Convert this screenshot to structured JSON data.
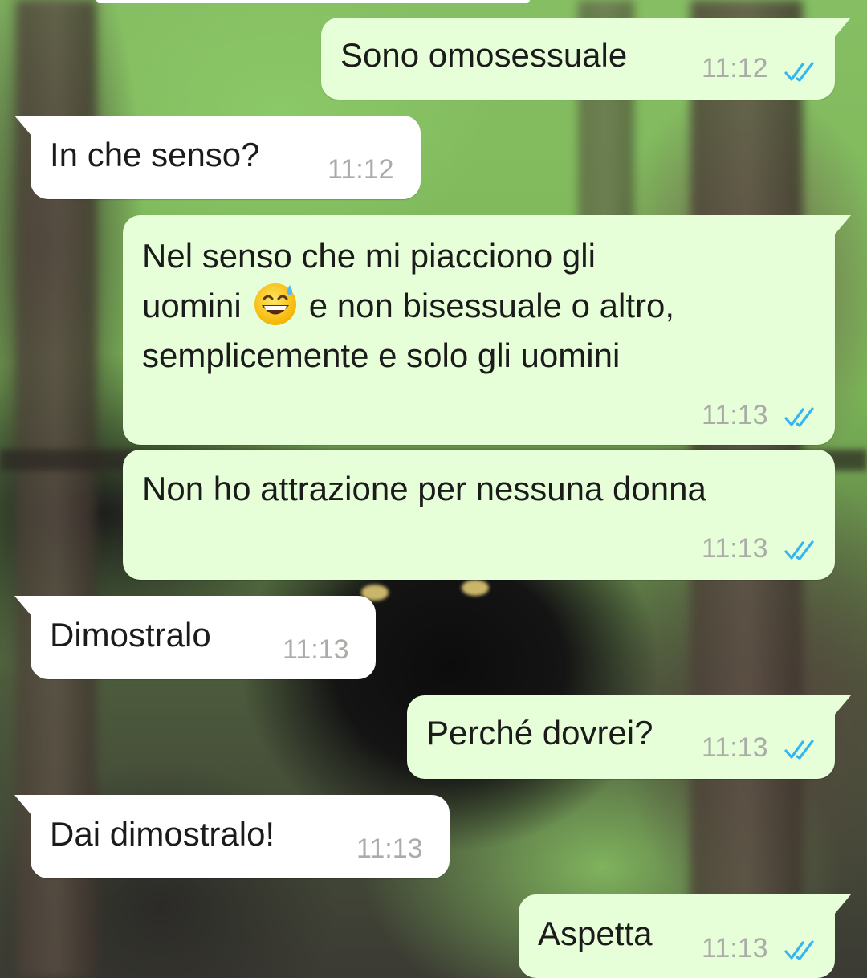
{
  "colors": {
    "outgoing_bubble": "#e6ffd9",
    "incoming_bubble": "#ffffff",
    "text": "#1b1b1b",
    "timestamp": "#a9aca7",
    "read_ticks": "#34b7f1"
  },
  "icons": {
    "read_receipt": "double-check-icon",
    "emoji": "grinning-face-with-sweat-emoji"
  },
  "messages": [
    {
      "direction": "outgoing",
      "text": "Sono omosessuale",
      "time": "11:12",
      "status": "read"
    },
    {
      "direction": "incoming",
      "text": "In che senso?",
      "time": "11:12"
    },
    {
      "direction": "outgoing",
      "text_before_emoji": "Nel senso che mi piacciono gli\nuomini",
      "text_after_emoji": "e non bisessuale o altro,\nsemplicemente e solo gli uomini",
      "time": "11:13",
      "status": "read"
    },
    {
      "direction": "outgoing",
      "text": "Non ho attrazione per nessuna donna",
      "time": "11:13",
      "status": "read"
    },
    {
      "direction": "incoming",
      "text": "Dimostralo",
      "time": "11:13"
    },
    {
      "direction": "outgoing",
      "text": "Perché dovrei?",
      "time": "11:13",
      "status": "read"
    },
    {
      "direction": "incoming",
      "text": "Dai dimostralo!",
      "time": "11:13"
    },
    {
      "direction": "outgoing",
      "text": "Aspetta",
      "time": "11:13",
      "status": "read"
    }
  ]
}
